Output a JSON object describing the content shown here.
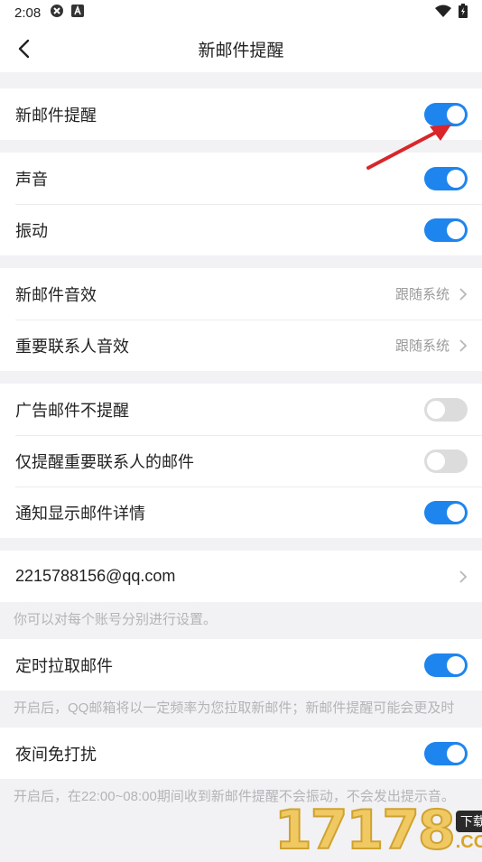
{
  "status_bar": {
    "time": "2:08"
  },
  "nav": {
    "title": "新邮件提醒"
  },
  "groups": {
    "new_mail": {
      "label": "新邮件提醒",
      "on": true
    },
    "sound": {
      "label": "声音",
      "on": true
    },
    "vibrate": {
      "label": "振动",
      "on": true
    },
    "new_mail_sound": {
      "label": "新邮件音效",
      "value": "跟随系统"
    },
    "vip_sound": {
      "label": "重要联系人音效",
      "value": "跟随系统"
    },
    "no_ads": {
      "label": "广告邮件不提醒",
      "on": false
    },
    "vip_only": {
      "label": "仅提醒重要联系人的邮件",
      "on": false
    },
    "show_detail": {
      "label": "通知显示邮件详情",
      "on": true
    },
    "account": {
      "label": "2215788156@qq.com"
    },
    "account_hint": "你可以对每个账号分别进行设置。",
    "timed_fetch": {
      "label": "定时拉取邮件",
      "on": true
    },
    "timed_fetch_hint": "开启后，QQ邮箱将以一定频率为您拉取新邮件；新邮件提醒可能会更及时",
    "night_mode": {
      "label": "夜间免打扰",
      "on": true
    },
    "night_hint": "开启后，在22:00~08:00期间收到新邮件提醒不会振动，不会发出提示音。"
  },
  "watermark": {
    "number": "17178",
    "tag": "下载站",
    "domain": ".COM"
  },
  "colors": {
    "accent": "#1f85ee",
    "annotation_arrow": "#d8262a"
  }
}
